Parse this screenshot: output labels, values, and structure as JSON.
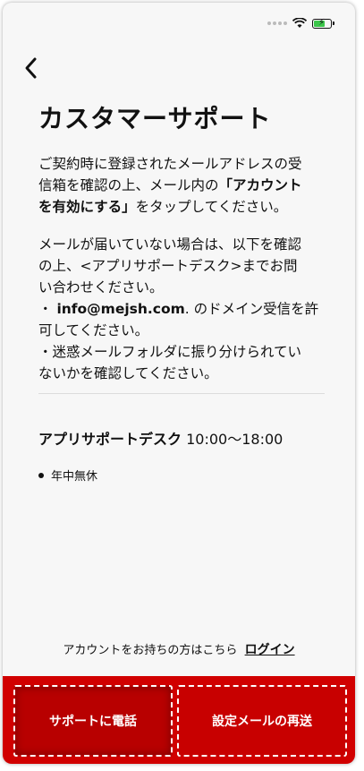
{
  "status_bar": {
    "wifi_icon": "wifi-icon",
    "battery_icon": "battery-charging-icon",
    "battery_color": "#3cc64a"
  },
  "header": {
    "back_icon": "chevron-left-icon",
    "title": "カスタマーサポート"
  },
  "body": {
    "p1_line1": "ご契約時に登録されたメールアドレスの受",
    "p1_line2_a": "信箱を確認の上、メール内の",
    "p1_line2_b": "「アカウント",
    "p1_line3_a": "を有効にする」",
    "p1_line3_b": "をタップしてください。",
    "p2_line1": "メールが届いていない場合は、以下を確認",
    "p2_line2": "の上、<アプリサポートデスク>までお問",
    "p2_line3": "い合わせください。",
    "p2_line4_a": "・ ",
    "p2_line4_b": "info@mejsh.com",
    "p2_line4_c": ". のドメイン受信を許",
    "p2_line5": "可してください。",
    "p2_line6": "・迷惑メールフォルダに振り分けられてい",
    "p2_line7": "ないかを確認してください。"
  },
  "support_desk": {
    "label": "アプリサポートデスク",
    "hours": " 10:00〜18:00",
    "note": "年中無休"
  },
  "login": {
    "prompt": "アカウントをお持ちの方はこちら",
    "link": "ログイン"
  },
  "buttons": {
    "call": "サポートに電話",
    "resend": "設定メールの再送"
  },
  "colors": {
    "accent": "#d10000",
    "background": "#f7f7f7"
  }
}
